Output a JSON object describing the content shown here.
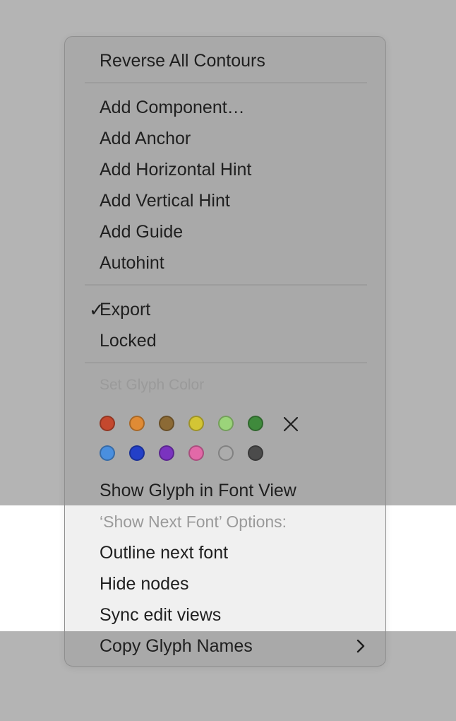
{
  "menu": {
    "items": {
      "reverse_all_contours": "Reverse All Contours",
      "add_component": "Add Component…",
      "add_anchor": "Add Anchor",
      "add_horizontal_hint": "Add Horizontal Hint",
      "add_vertical_hint": "Add Vertical Hint",
      "add_guide": "Add Guide",
      "autohint": "Autohint",
      "export": "Export",
      "export_checkmark": "✓",
      "locked": "Locked",
      "set_glyph_color": "Set Glyph Color",
      "show_glyph_in_font_view": "Show Glyph in Font View",
      "show_next_font_options": "‘Show Next Font’ Options:",
      "outline_next_font": "Outline next font",
      "hide_nodes": "Hide nodes",
      "sync_edit_views": "Sync edit views",
      "copy_glyph_names": "Copy Glyph Names"
    },
    "export_checked": true,
    "glyph_colors": {
      "row1": [
        "#c4482e",
        "#e08b35",
        "#8c6a35",
        "#d3c535",
        "#9bd47a",
        "#3f8a3c"
      ],
      "row2": [
        "#4a8fde",
        "#2340c8",
        "#7a33bf",
        "#e269a8",
        "#acacac",
        "#4b4b4b"
      ]
    },
    "icons": {
      "clear_color": "close-icon",
      "submenu": "chevron-right-icon"
    }
  }
}
